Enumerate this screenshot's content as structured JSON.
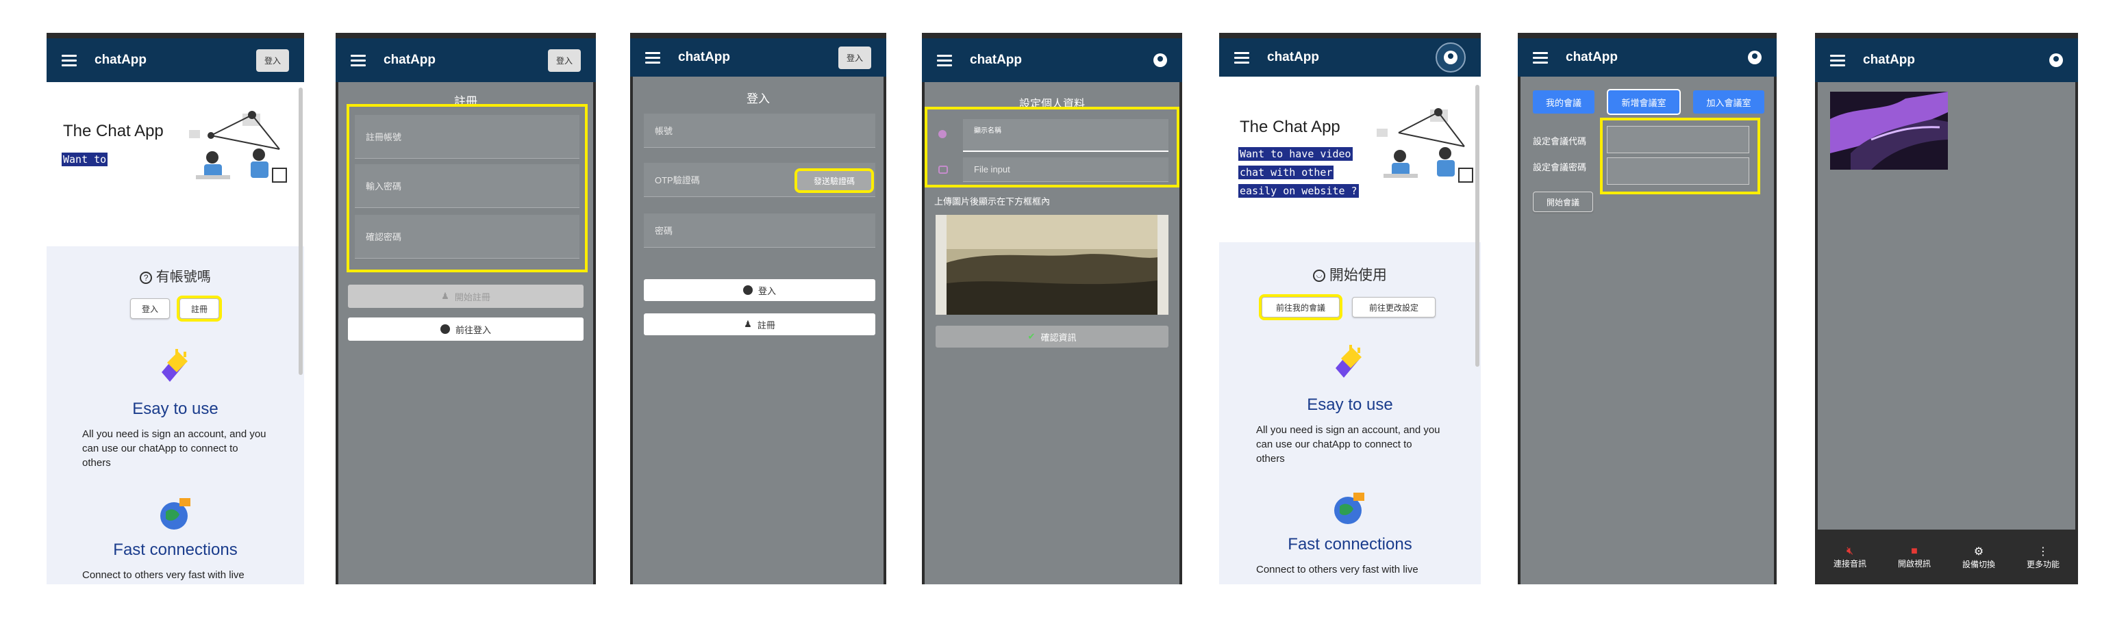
{
  "app": {
    "brand": "chatApp"
  },
  "s1": {
    "login_btn": "登入",
    "hero_title": "The Chat App",
    "hero_code": "Want to",
    "question": "有帳號嗎",
    "login": "登入",
    "register": "註冊",
    "feature1_title": "Esay to use",
    "feature1_body": "All you need is sign an account, and you can use our chatApp to connect to others",
    "feature2_title": "Fast connections",
    "feature2_body": "Connect to others very fast with live"
  },
  "s2": {
    "login_btn": "登入",
    "title": "註冊",
    "account_placeholder": "註冊帳號",
    "password_placeholder": "輸入密碼",
    "confirm_placeholder": "確認密碼",
    "register_btn": "開始註冊",
    "goto_login_btn": "前往登入"
  },
  "s3": {
    "login_btn": "登入",
    "title": "登入",
    "account_placeholder": "帳號",
    "otp_placeholder": "OTP驗證碼",
    "send_code_btn": "發送驗證碼",
    "password_placeholder": "密碼",
    "login_btn_main": "登入",
    "register_btn": "註冊"
  },
  "s4": {
    "title": "設定個人資料",
    "display_name_label": "顯示名稱",
    "file_input": "File input",
    "upload_hint": "上傳圖片後顯示在下方框框內",
    "confirm_btn": "確認資訊"
  },
  "s5": {
    "hero_title": "The Chat App",
    "hero_code": [
      "Want to have video",
      "chat with other",
      "easily on website ?"
    ],
    "start_title": "開始使用",
    "my_meeting_btn": "前往我的會議",
    "settings_btn": "前往更改設定",
    "feature1_title": "Esay to use",
    "feature1_body": "All you need is sign an account, and you can use our chatApp to connect to others",
    "feature2_title": "Fast connections",
    "feature2_body": "Connect to others very fast with live"
  },
  "s6": {
    "tabs": [
      "我的會議",
      "新增會議室",
      "加入會議室"
    ],
    "code_label": "設定會議代碼",
    "password_label": "設定會議密碼",
    "open_btn": "開始會議"
  },
  "s7": {
    "controls": [
      "連接音訊",
      "開啟視訊",
      "設備切換",
      "更多功能"
    ]
  },
  "colors": {
    "appbar": "#0d3557",
    "highlight": "#ffee00",
    "tab_blue": "#3b82f6",
    "link_blue": "#1a3c8c"
  }
}
